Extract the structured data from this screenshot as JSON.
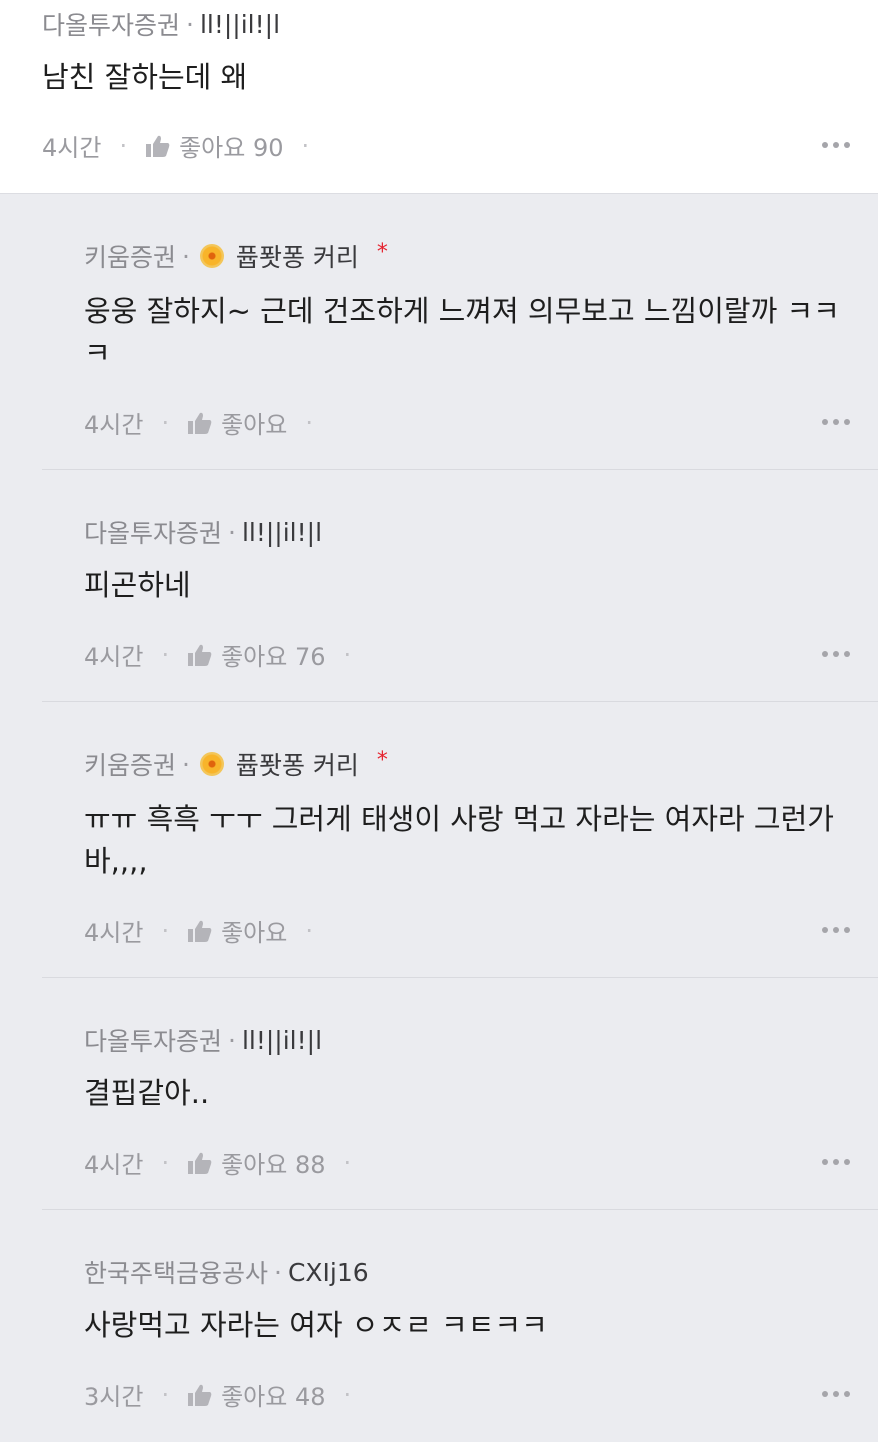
{
  "comments": [
    {
      "company": "다올투자증권",
      "nickname": "ll!||il!|l",
      "text": "남친 잘하는데 왜",
      "time": "4시간",
      "like_label": "좋아요 90"
    },
    {
      "company": "키움증권",
      "nickname": "퓹퐛퐁 커리",
      "badge": "medal-icon",
      "star": "*",
      "text": "웅웅 잘하지~ 근데 건조하게 느껴져 의무보고 느낌이랄까 ㅋㅋ\nㅋ",
      "time": "4시간",
      "like_label": "좋아요"
    },
    {
      "company": "다올투자증권",
      "nickname": "ll!||il!|l",
      "text": "피곤하네",
      "time": "4시간",
      "like_label": "좋아요 76"
    },
    {
      "company": "키움증권",
      "nickname": "퓹퐛퐁 커리",
      "badge": "medal-icon",
      "star": "*",
      "text": "ㅠㅠ 흑흑 ㅜㅜ 그러게 태생이 사랑 먹고 자라는 여자라 그런가\n바,,,,",
      "time": "4시간",
      "like_label": "좋아요"
    },
    {
      "company": "다올투자증권",
      "nickname": "ll!||il!|l",
      "text": "결핍같아..",
      "time": "4시간",
      "like_label": "좋아요 88"
    },
    {
      "company": "한국주택금융공사",
      "nickname": "CXIj16",
      "text": "사랑먹고 자라는 여자 ㅇㅈㄹ ㅋㅌㅋㅋ",
      "time": "3시간",
      "like_label": "좋아요 48"
    }
  ],
  "colors": {
    "background": "#ebecf0",
    "card": "#ffffff",
    "star": "#e5232f",
    "muted": "#8b8b90"
  },
  "icons": {
    "like": "thumbs-up-icon",
    "more": "more-dots-icon",
    "medal": "medal-icon"
  }
}
